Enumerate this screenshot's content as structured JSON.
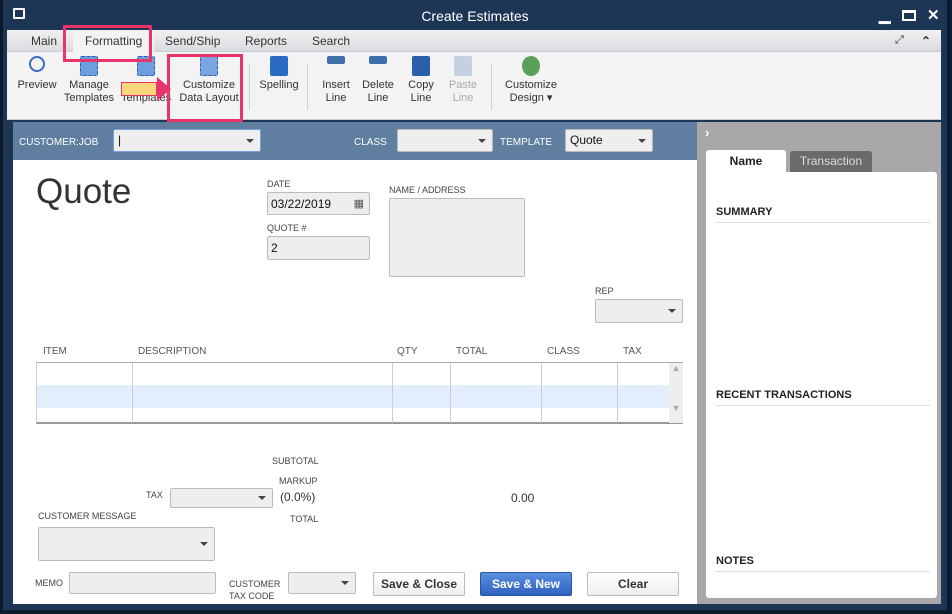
{
  "window": {
    "title": "Create Estimates"
  },
  "tabs": [
    "Main",
    "Formatting",
    "Send/Ship",
    "Reports",
    "Search"
  ],
  "toolbar": [
    {
      "label1": "Preview",
      "label2": "",
      "icon": "preview-icon"
    },
    {
      "label1": "Manage",
      "label2": "Templates",
      "icon": "manage-templates-icon"
    },
    {
      "label1": "",
      "label2": "Templates",
      "icon": "templates-icon"
    },
    {
      "label1": "Customize",
      "label2": "Data Layout",
      "icon": "customize-data-layout-icon"
    },
    {
      "label1": "Spelling",
      "label2": "",
      "icon": "spelling-icon"
    },
    {
      "label1": "Insert",
      "label2": "Line",
      "icon": "insert-line-icon"
    },
    {
      "label1": "Delete",
      "label2": "Line",
      "icon": "delete-line-icon"
    },
    {
      "label1": "Copy",
      "label2": "Line",
      "icon": "copy-line-icon"
    },
    {
      "label1": "Paste",
      "label2": "Line",
      "icon": "paste-line-icon"
    },
    {
      "label1": "Customize",
      "label2": "Design ▾",
      "icon": "customize-design-icon"
    }
  ],
  "header": {
    "customer_job_label": "CUSTOMER:JOB",
    "customer_job_value": "",
    "class_label": "CLASS",
    "class_value": "",
    "template_label": "TEMPLATE",
    "template_value": "Quote"
  },
  "form": {
    "title": "Quote",
    "date_label": "DATE",
    "date_value": "03/22/2019",
    "quote_label": "QUOTE #",
    "quote_value": "2",
    "name_address_label": "NAME / ADDRESS",
    "rep_label": "REP"
  },
  "table": {
    "columns": [
      "ITEM",
      "DESCRIPTION",
      "QTY",
      "TOTAL",
      "CLASS",
      "TAX"
    ]
  },
  "totals": {
    "subtotal_label": "SUBTOTAL",
    "tax_label": "TAX",
    "markup_label": "MARKUP",
    "markup_pct": "(0.0%)",
    "markup_value": "0.00",
    "total_label": "TOTAL"
  },
  "footer": {
    "customer_message_label": "CUSTOMER MESSAGE",
    "memo_label": "MEMO",
    "tax_code_label1": "CUSTOMER",
    "tax_code_label2": "TAX CODE",
    "save_close": "Save & Close",
    "save_new": "Save & New",
    "clear": "Clear"
  },
  "side": {
    "tab_name": "Name",
    "tab_transaction": "Transaction",
    "summary": "SUMMARY",
    "recent": "RECENT TRANSACTIONS",
    "notes": "NOTES"
  },
  "colors": {
    "accent": "#e8336b",
    "band": "#5f7ea0",
    "primary_button": "#3a6cc7"
  }
}
